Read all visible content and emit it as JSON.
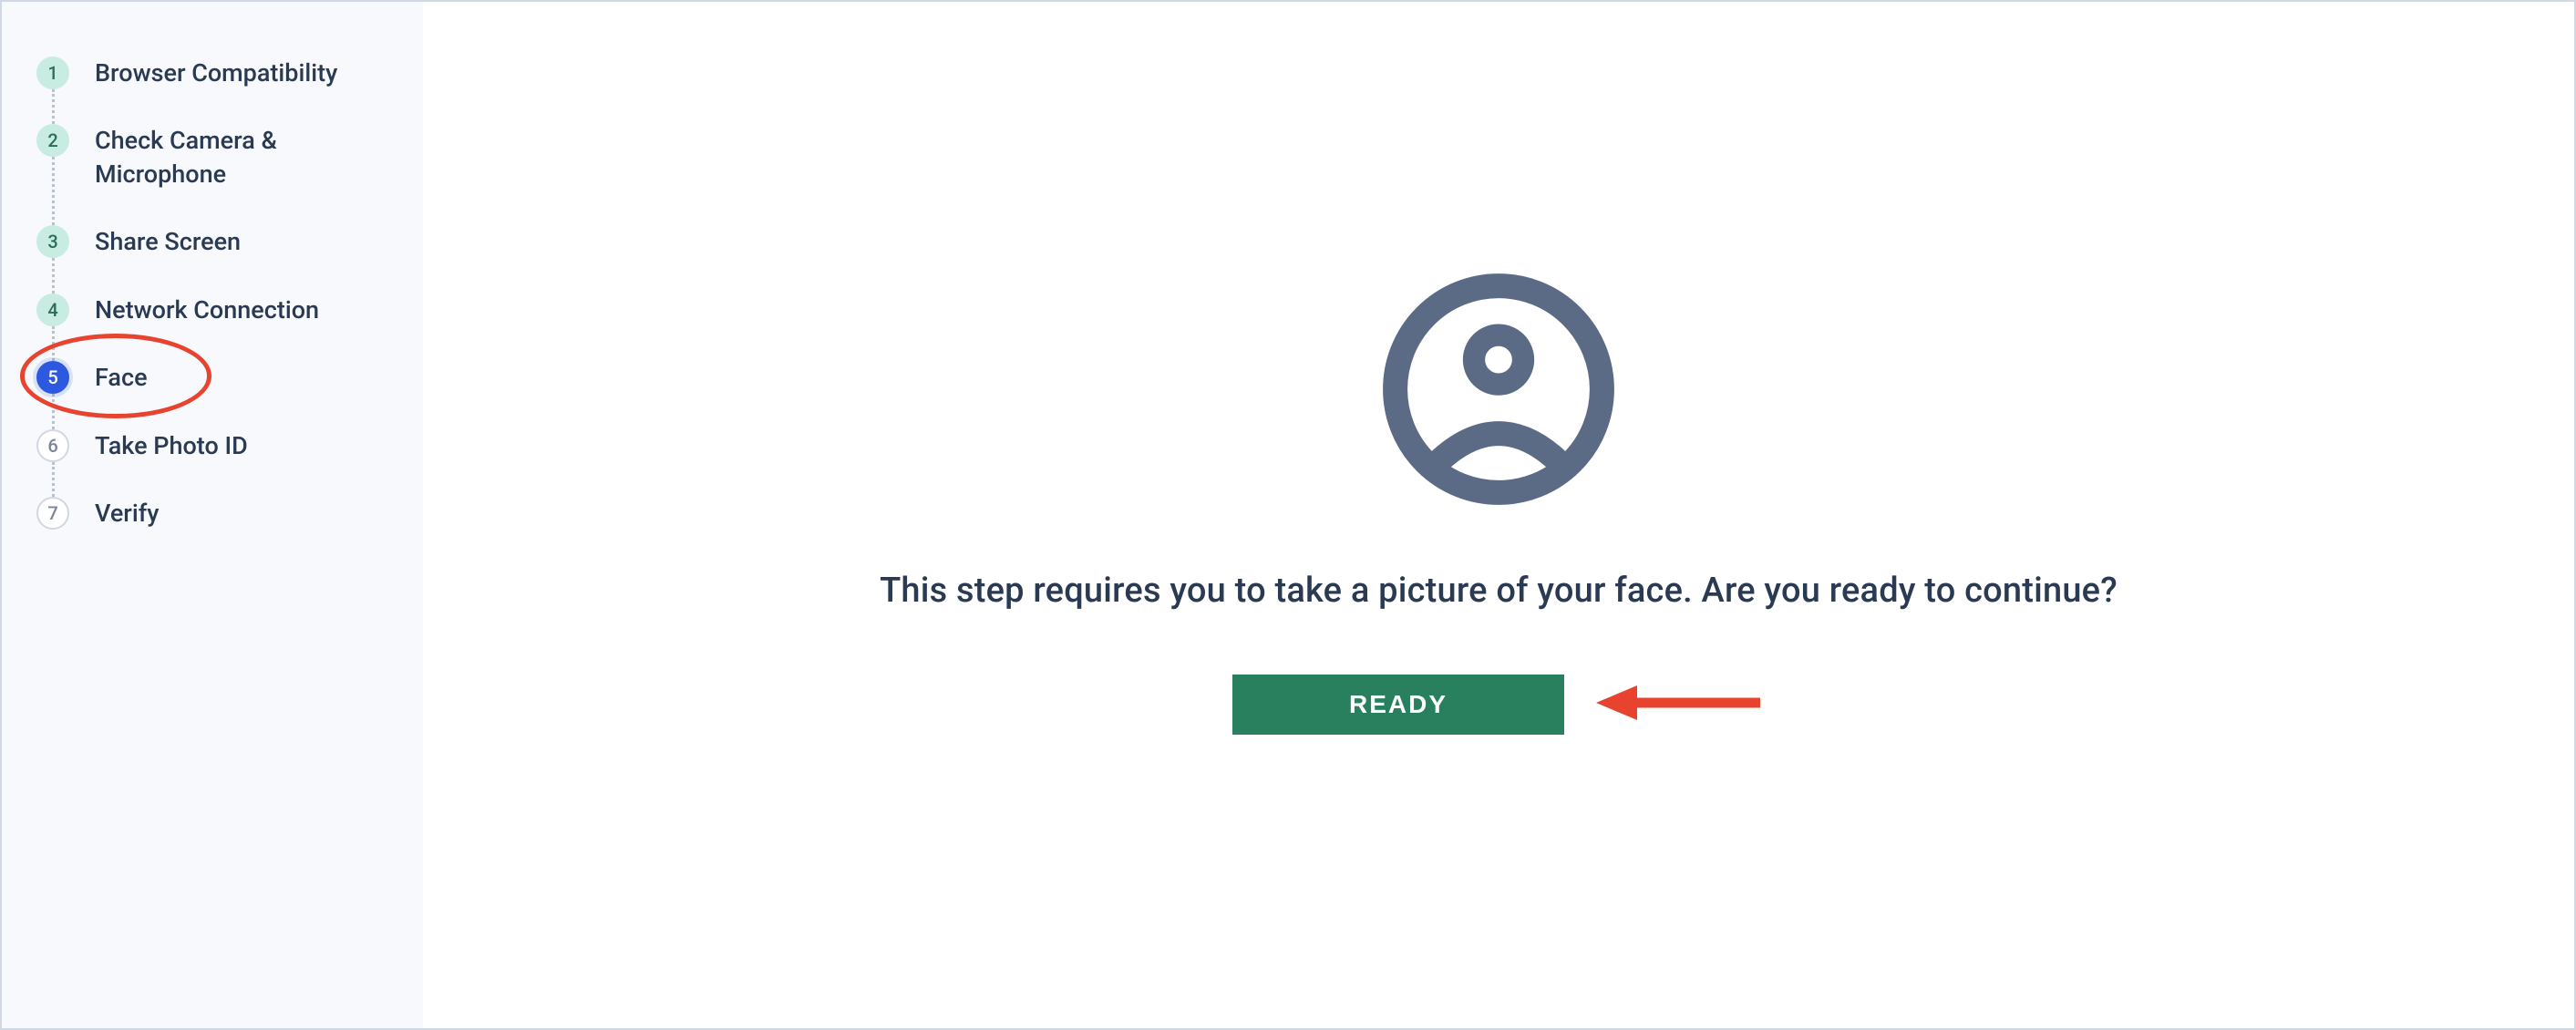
{
  "sidebar": {
    "steps": [
      {
        "num": "1",
        "label": "Browser Compatibility",
        "state": "completed"
      },
      {
        "num": "2",
        "label": "Check Camera & Microphone",
        "state": "completed"
      },
      {
        "num": "3",
        "label": "Share Screen",
        "state": "completed"
      },
      {
        "num": "4",
        "label": "Network Connection",
        "state": "completed"
      },
      {
        "num": "5",
        "label": "Face",
        "state": "active"
      },
      {
        "num": "6",
        "label": "Take Photo ID",
        "state": "upcoming"
      },
      {
        "num": "7",
        "label": "Verify",
        "state": "upcoming"
      }
    ]
  },
  "main": {
    "prompt": "This step requires you to take a picture of your face. Are you ready to continue?",
    "ready_label": "READY"
  }
}
